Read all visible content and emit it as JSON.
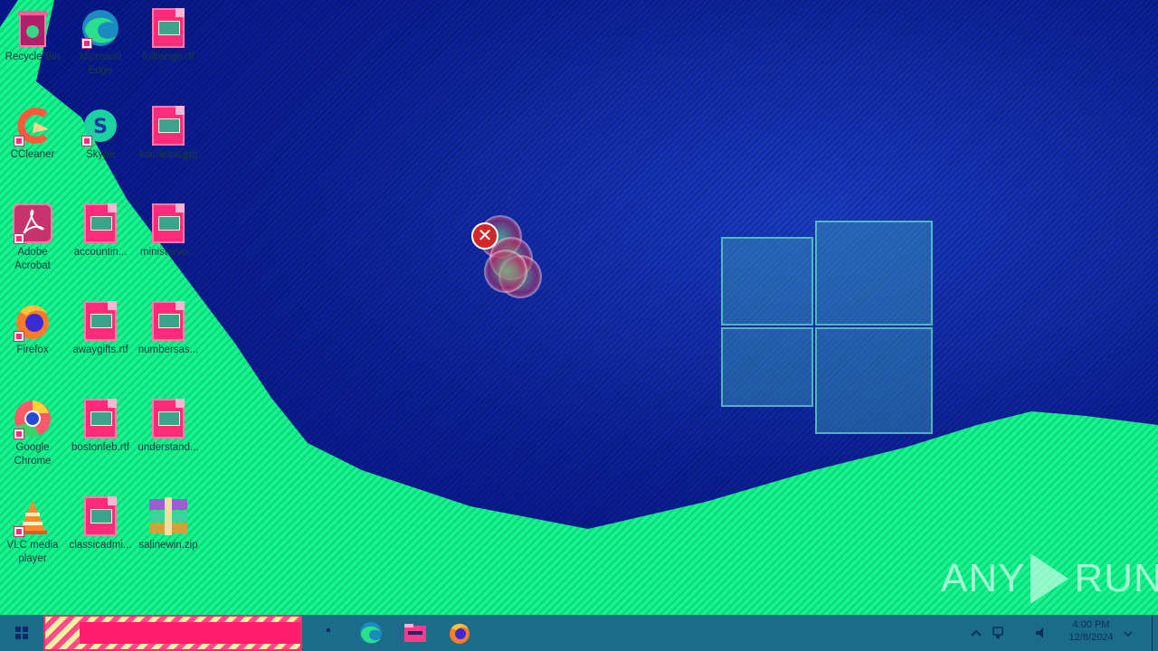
{
  "desktop": {
    "icons": [
      {
        "label": "Recycle Bin"
      },
      {
        "label": "Microsoft Edge"
      },
      {
        "label": "fullrange.rtf"
      },
      {
        "label": "CCleaner"
      },
      {
        "label": "Skype"
      },
      {
        "label": "loanleast.jpg"
      },
      {
        "label": "Adobe Acrobat"
      },
      {
        "label": "accountin..."
      },
      {
        "label": "ministervo..."
      },
      {
        "label": "Firefox"
      },
      {
        "label": "awaygifts.rtf"
      },
      {
        "label": "numbersas..."
      },
      {
        "label": "Google Chrome"
      },
      {
        "label": "bostonfeb.rtf"
      },
      {
        "label": "understand..."
      },
      {
        "label": "VLC media player"
      },
      {
        "label": "classicadmi..."
      },
      {
        "label": "salinewin.zip"
      }
    ],
    "error_icon_glyph": "✕"
  },
  "watermark": {
    "left": "ANY",
    "right": "RUN"
  },
  "taskbar": {
    "pinned": [
      "edge-icon",
      "file-explorer-icon",
      "firefox-icon"
    ],
    "tray": {
      "time": "4:00 PM",
      "date": "12/8/2024"
    }
  },
  "colors": {
    "desktop_blue": "#0b1a8a",
    "wave_green": "#1aff8c",
    "taskbar": "#1b6c88",
    "error_red": "#d3262a"
  }
}
